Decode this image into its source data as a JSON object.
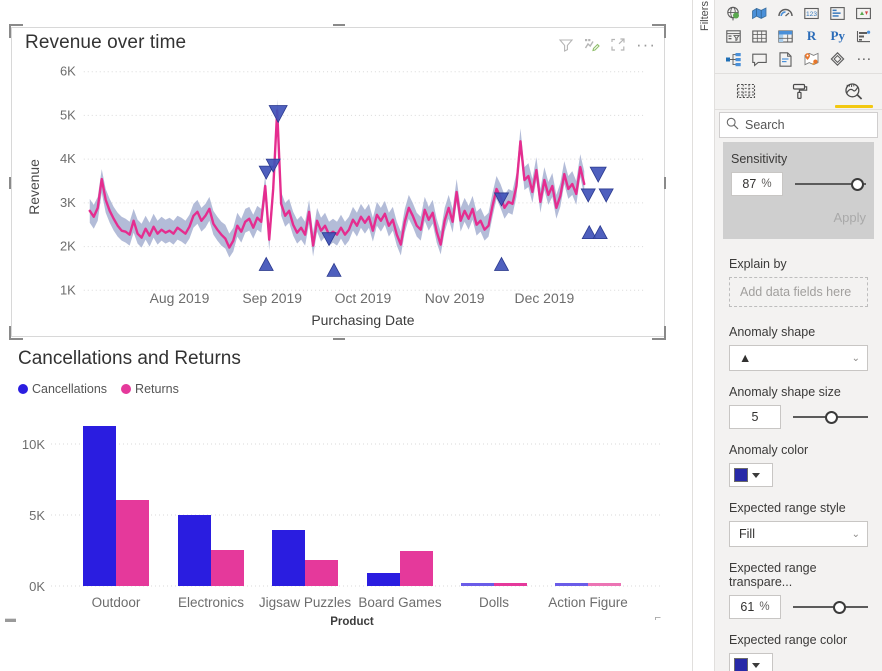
{
  "canvas": {
    "visual_line": {
      "title": "Revenue over time",
      "header_icons": [
        "filter-icon",
        "edit-anomaly-icon",
        "focus-mode-icon",
        "more-options-icon"
      ]
    },
    "visual_bar": {
      "title": "Cancellations and Returns"
    }
  },
  "chart_data": [
    {
      "type": "line",
      "title": "Revenue over time",
      "xlabel": "Purchasing Date",
      "ylabel": "Revenue",
      "ylim": [
        1000,
        6000
      ],
      "yticks": [
        1000,
        2000,
        3000,
        4000,
        5000,
        6000
      ],
      "ytick_labels": [
        "1K",
        "2K",
        "3K",
        "4K",
        "5K",
        "6K"
      ],
      "xtick_labels": [
        "Aug 2019",
        "Sep 2019",
        "Oct 2019",
        "Nov 2019",
        "Dec 2019"
      ],
      "grid": true,
      "legend": "none",
      "series": [
        {
          "name": "Revenue",
          "color": "#e52d8f",
          "values": [
            2850,
            2760,
            2980,
            3700,
            3180,
            2900,
            2700,
            2520,
            2400,
            2360,
            2280,
            2620,
            2340,
            2250,
            2480,
            2260,
            2520,
            2300,
            2430,
            2320,
            2380,
            2300,
            2420,
            2360,
            2300,
            2460,
            2720,
            2820,
            2620,
            2740,
            2900,
            2560,
            2380,
            2250,
            2160,
            1920,
            2080,
            2440,
            2300,
            2540,
            2600,
            2400,
            2620,
            2560,
            3320,
            2200,
            3260,
            5200,
            3020,
            2820,
            2900,
            2600,
            2420,
            2500,
            2360,
            2860,
            2040,
            2620,
            2420,
            2520,
            2300,
            2380,
            2300,
            2480,
            2300,
            2420,
            2620,
            2480,
            2700,
            2560,
            2700,
            2420,
            2780,
            2640,
            2800,
            2540,
            2680,
            2340,
            2160,
            2540,
            2980,
            2800,
            2560,
            2480,
            2920,
            2700,
            2860,
            2380,
            2160,
            2600,
            2980,
            2620,
            3280,
            2700,
            2900,
            2720,
            2960,
            2640,
            2740,
            2480,
            2560,
            3000,
            3400,
            3220,
            2980,
            3120,
            3080,
            3460,
            4480,
            3600,
            3700,
            3340,
            3820,
            3100,
            3620,
            3200,
            3480,
            2980,
            3240,
            3760,
            3420,
            3540,
            3300,
            3900,
            3520,
            3480
          ]
        },
        {
          "name": "Expected range",
          "color": "#8f9bc4",
          "kind": "band"
        }
      ],
      "anomalies": [
        {
          "index": 44,
          "direction": "down",
          "value": 3380
        },
        {
          "index": 45,
          "direction": "up",
          "value": 2180
        },
        {
          "index": 46,
          "direction": "down",
          "value": 3900
        },
        {
          "index": 47,
          "direction": "down",
          "value": 5520
        },
        {
          "index": 62,
          "direction": "down",
          "value": 2720
        },
        {
          "index": 64,
          "direction": "up",
          "value": 2080
        },
        {
          "index": 92,
          "direction": "down",
          "value": 3560
        },
        {
          "index": 93,
          "direction": "up",
          "value": 2180
        },
        {
          "index": 114,
          "direction": "down",
          "value": 4160
        },
        {
          "index": 116,
          "direction": "down",
          "value": 3900
        },
        {
          "index": 118,
          "direction": "down",
          "value": 3880
        },
        {
          "index": 117,
          "direction": "up",
          "value": 2920
        },
        {
          "index": 119,
          "direction": "up",
          "value": 2920
        }
      ],
      "anomaly_color": "#3b4ba8"
    },
    {
      "type": "bar",
      "title": "Cancellations and Returns",
      "xlabel": "Product",
      "ylabel": "",
      "ylim": [
        0,
        12500
      ],
      "yticks": [
        0,
        5000,
        10000
      ],
      "ytick_labels": [
        "0K",
        "5K",
        "10K"
      ],
      "grid": true,
      "legend": "top-left",
      "categories": [
        "Outdoor",
        "Electronics",
        "Jigsaw Puzzles",
        "Board Games",
        "Dolls",
        "Action Figure"
      ],
      "series": [
        {
          "name": "Cancellations",
          "color": "#2a1de0",
          "values": [
            11300,
            5050,
            3950,
            900,
            40,
            40
          ]
        },
        {
          "name": "Returns",
          "color": "#e5399b",
          "values": [
            6050,
            2550,
            1850,
            2500,
            40,
            40
          ]
        }
      ]
    }
  ],
  "right_panel": {
    "vertical_tab_label": "Filters",
    "viz_gallery": {
      "icons": [
        "globe-map-icon",
        "filled-map-icon",
        "gauge-icon",
        "card-icon",
        "multi-row-card-icon",
        "kpi-icon",
        "slicer-icon",
        "table-icon",
        "matrix-icon",
        "r-script-visual-icon",
        "python-visual-icon",
        "key-influencers-icon",
        "decomposition-tree-icon",
        "qna-icon",
        "paginated-report-icon",
        "arcgis-map-icon",
        "power-apps-icon",
        "more-visuals-icon"
      ],
      "labels": {
        "r": "R",
        "py": "Py"
      }
    },
    "pane_tabs": [
      {
        "name": "fields",
        "icon": "fields-table-icon",
        "active": false
      },
      {
        "name": "format",
        "icon": "format-paint-roller-icon",
        "active": false
      },
      {
        "name": "analytics",
        "icon": "analytics-magnifier-icon",
        "active": true
      }
    ],
    "search": {
      "placeholder": "Search",
      "value": ""
    },
    "sections": {
      "sensitivity": {
        "label": "Sensitivity",
        "value": "87",
        "unit": "%",
        "slider_pct": 87,
        "apply_label": "Apply"
      },
      "explain_by": {
        "label": "Explain by",
        "dropzone_placeholder": "Add data fields here"
      },
      "anomaly_shape": {
        "label": "Anomaly shape",
        "value": "▲"
      },
      "anomaly_shape_size": {
        "label": "Anomaly shape size",
        "value": "5",
        "slider_pct": 50
      },
      "anomaly_color": {
        "label": "Anomaly color",
        "color": "#2729a8"
      },
      "expected_range_style": {
        "label": "Expected range style",
        "value": "Fill"
      },
      "expected_range_transparency": {
        "label": "Expected range transpare...",
        "value": "61",
        "unit": "%",
        "slider_pct": 61
      },
      "expected_range_color": {
        "label": "Expected range color",
        "color": "#2729a8"
      }
    }
  }
}
